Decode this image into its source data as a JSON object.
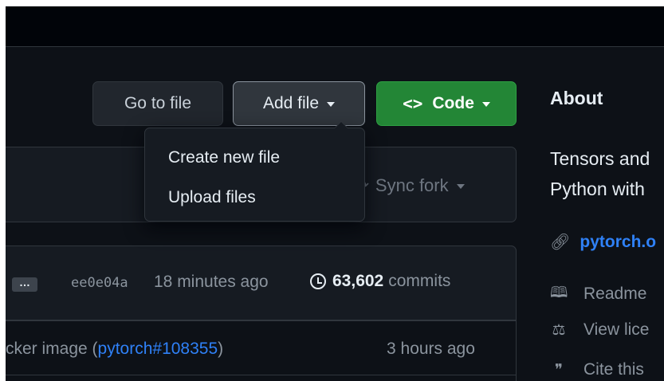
{
  "toolbar": {
    "go_to_file": "Go to file",
    "add_file": "Add file",
    "code": "Code",
    "code_icon": "<>"
  },
  "dropdown": {
    "items": [
      {
        "label": "Create new file"
      },
      {
        "label": "Upload files"
      }
    ]
  },
  "sync": {
    "label": "Sync fork",
    "icon": "sync-icon"
  },
  "latest_commit": {
    "ellipsis": "…",
    "sha": "ee0e04a",
    "time_ago": "18 minutes ago",
    "count": "63,602",
    "count_label": "commits"
  },
  "file_row": {
    "message_prefix": "cker image (",
    "link": "pytorch#108355",
    "message_suffix": ")",
    "time": "3 hours ago"
  },
  "about": {
    "title": "About",
    "desc_line1": "Tensors and",
    "desc_line2": "Python with",
    "link": "pytorch.o",
    "items": [
      {
        "label": "Readme",
        "icon": "book-icon"
      },
      {
        "label": "View lice",
        "icon": "law-icon"
      },
      {
        "label": "Cite this",
        "icon": "quote-icon"
      }
    ]
  },
  "colors": {
    "bg": "#0d1117",
    "button_bg": "#21262d",
    "code_green": "#238636",
    "link_blue": "#2f81f7",
    "muted_text": "#8b949e"
  }
}
